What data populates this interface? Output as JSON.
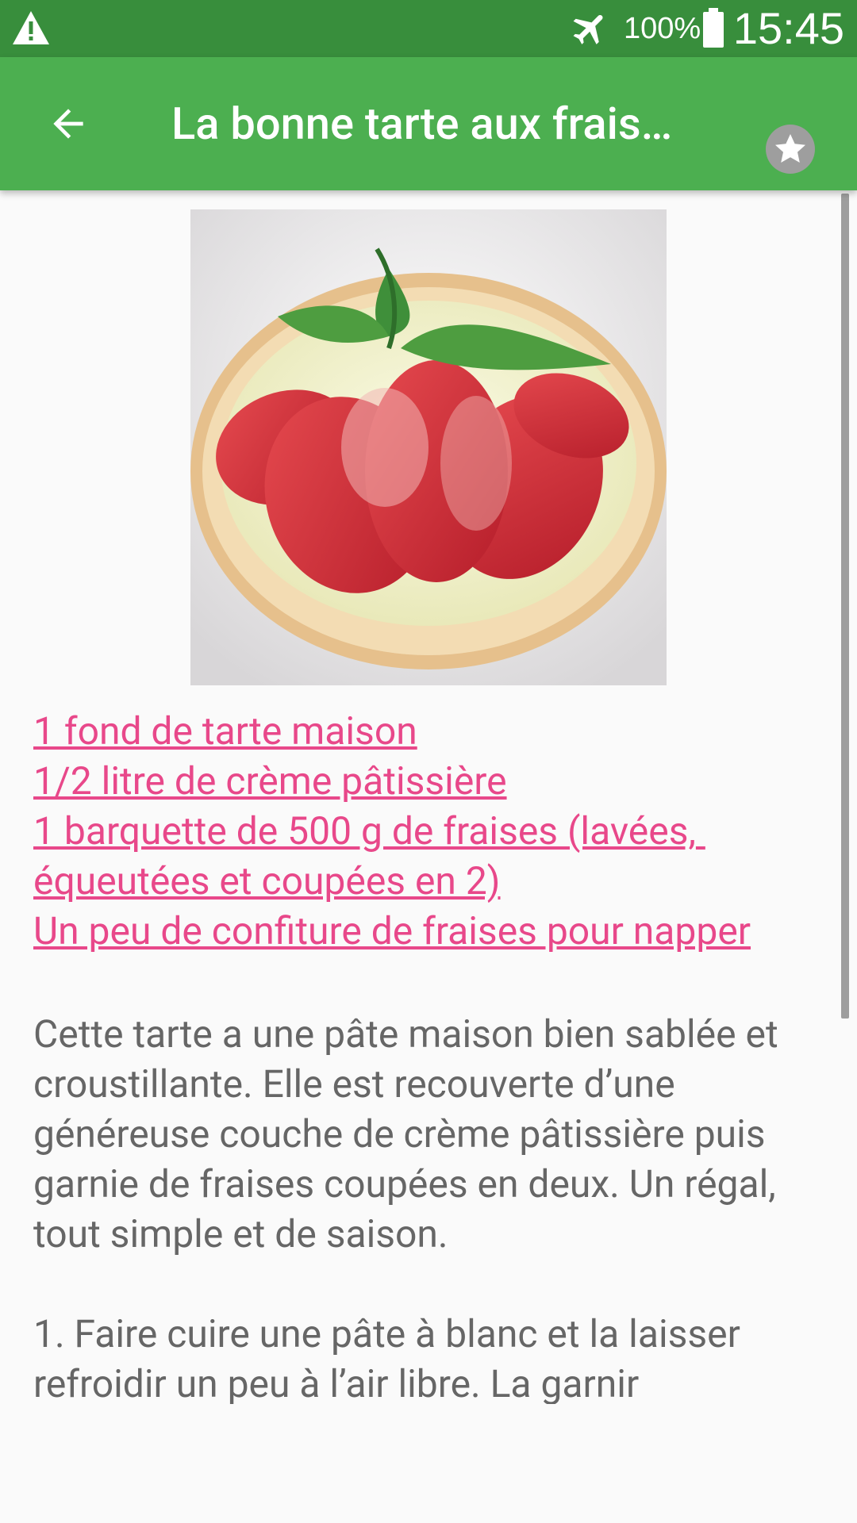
{
  "status_bar": {
    "battery_percent": "100%",
    "time": "15:45",
    "icons": [
      "warning-icon",
      "airplane-mode-icon",
      "battery-icon"
    ]
  },
  "app_bar": {
    "title": "La bonne tarte aux frais…",
    "icons": [
      "back-arrow-icon",
      "star-icon"
    ],
    "background": "#4caf50",
    "status_background": "#388e3c"
  },
  "recipe": {
    "ingredients": [
      "1 fond de tarte maison",
      "1/2 litre de crème pâtissière",
      "1 barquette de 500 g de fraises (lavées, équeutées et coupées en 2)",
      "Un peu de confiture de fraises pour napper"
    ],
    "description": "Cette tarte a une pâte maison bien sablée et croustillante. Elle est recouverte d’une généreuse couche de crème pâtissière puis garnie de fraises coupées en deux. Un régal, tout simple et de saison.",
    "step_1": "1. Faire cuire une pâte à blanc et la laisser refroidir un peu à l’air libre. La garnir",
    "link_color": "#e8488a",
    "text_color": "#666666"
  }
}
